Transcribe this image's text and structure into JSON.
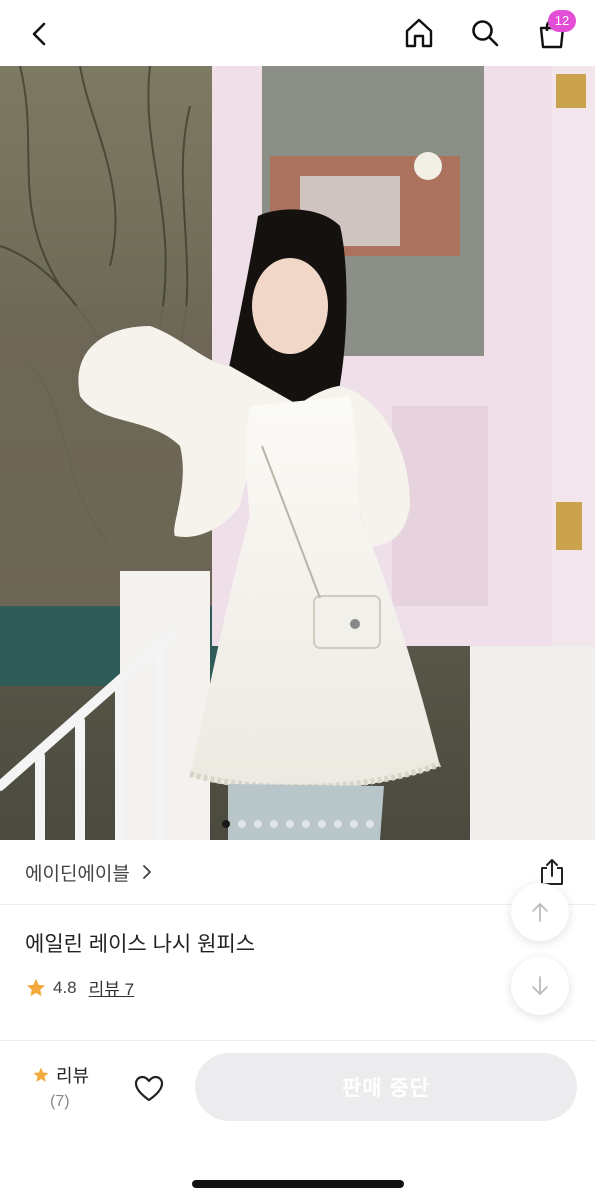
{
  "header": {
    "cart_count": "12",
    "icons": [
      "back-icon",
      "home-icon",
      "search-icon",
      "cart-icon"
    ],
    "badge_color": "#e24fd6"
  },
  "gallery": {
    "image": "model in white lace sleeveless dress with knit cardigan and crossbody bag",
    "total_slides": 10,
    "active_index": 0
  },
  "product": {
    "brand": "에이딘에이블",
    "name": "에일린 레이스 나시 원피스",
    "rating": "4.8",
    "review_link": "리뷰 7"
  },
  "bottom_bar": {
    "review_label": "리뷰",
    "review_count": "(7)",
    "cta_label": "판매 중단",
    "star_color": "#f2a93b"
  }
}
